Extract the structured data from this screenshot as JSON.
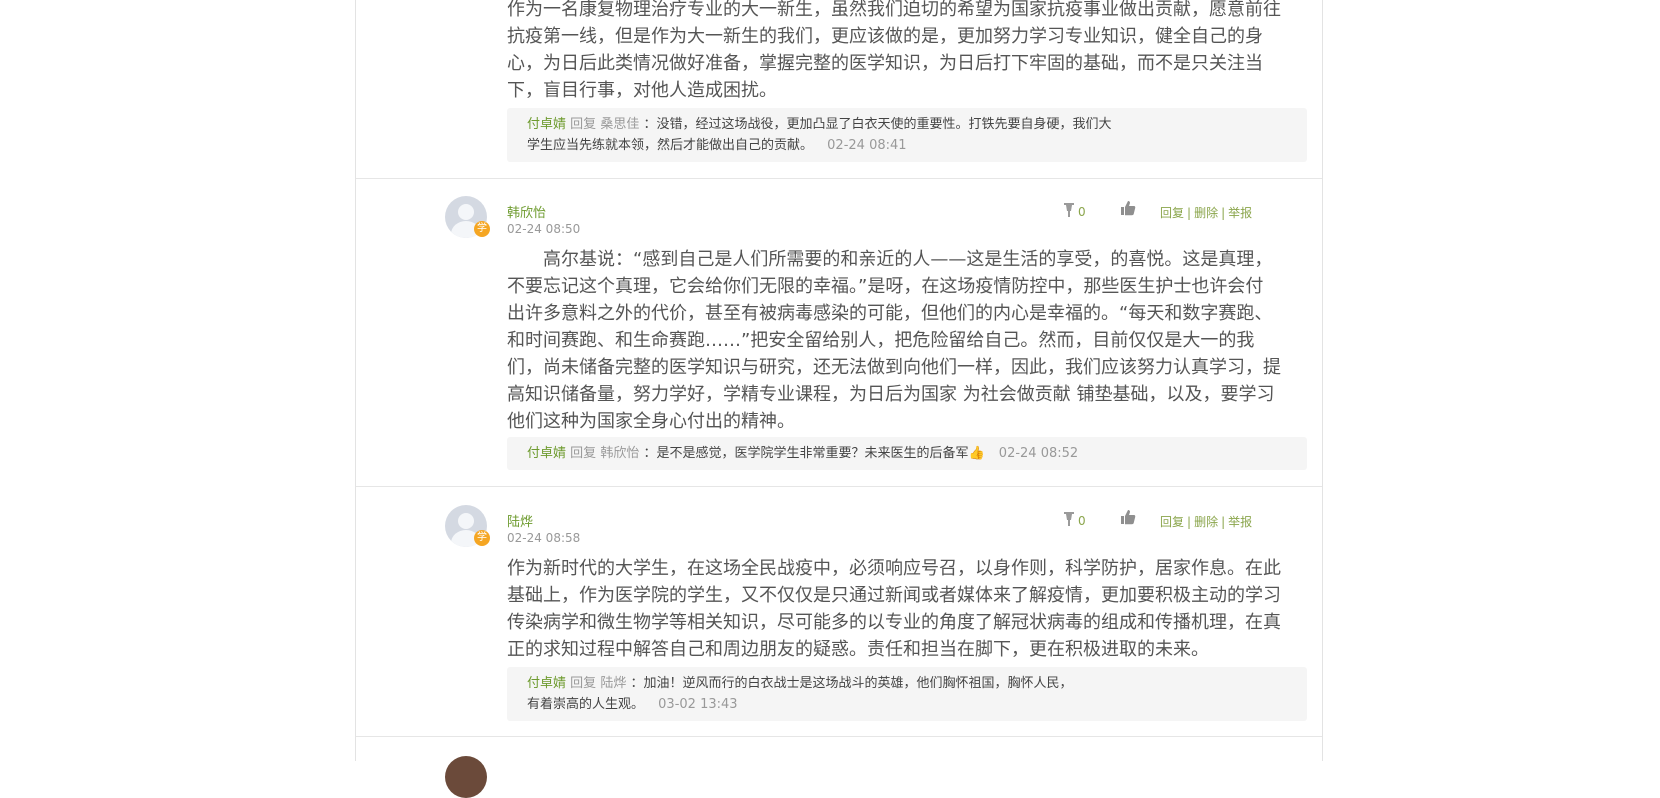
{
  "comments": [
    {
      "body_lines": [
        "作为一名康复物理治疗专业的大一新生，虽然我们迫切的希望为国家抗疫事业做出贡献，愿意前往",
        "抗疫第一线，但是作为大一新生的我们，更应该做的是，更加努力学习专业知识，健全自己的身",
        "心，为日后此类情况做好准备，掌握完整的医学知识，为日后打下牢固的基础，而不是只关注当",
        "下，盲目行事，对他人造成困扰。"
      ],
      "reply": {
        "author": "付卓婧",
        "word": "回复",
        "target": "桑思佳",
        "text_line1": "：没错，经过这场战役，更加凸显了白衣天使的重要性。打铁先要自身硬，我们大",
        "text_line2": "学生应当先练就本领，然后才能做出自己的贡献。",
        "time": "02-24 08:41"
      }
    },
    {
      "author": "韩欣怡",
      "time": "02-24 08:50",
      "badge": "学",
      "dislike_count": "0",
      "actions": {
        "reply": "回复",
        "delete": "删除",
        "report": "举报"
      },
      "body_lines": [
        "高尔基说：“感到自己是人们所需要的和亲近的人——这是生活的享受，的喜悦。这是真理，",
        "不要忘记这个真理，它会给你们无限的幸福。”是呀，在这场疫情防控中，那些医生护士也许会付",
        "出许多意料之外的代价，甚至有被病毒感染的可能，但他们的内心是幸福的。“每天和数字赛跑、",
        "和时间赛跑、和生命赛跑……”把安全留给别人，把危险留给自己。然而，目前仅仅是大一的我",
        "们，尚未储备完整的医学知识与研究，还无法做到向他们一样，因此，我们应该努力认真学习，提",
        "高知识储备量，努力学好，学精专业课程，为日后为国家 为社会做贡献 铺垫基础，以及，要学习",
        "他们这种为国家全身心付出的精神。"
      ],
      "reply": {
        "author": "付卓婧",
        "word": "回复",
        "target": "韩欣怡",
        "text_line1": "：是不是感觉，医学院学生非常重要？未来医生的后备军👍",
        "time": "02-24 08:52"
      }
    },
    {
      "author": "陆烨",
      "time": "02-24 08:58",
      "badge": "学",
      "dislike_count": "0",
      "actions": {
        "reply": "回复",
        "delete": "删除",
        "report": "举报"
      },
      "body_lines": [
        "作为新时代的大学生，在这场全民战疫中，必须响应号召，以身作则，科学防护，居家作息。在此",
        "基础上，作为医学院的学生，又不仅仅是只通过新闻或者媒体来了解疫情，更加要积极主动的学习",
        "传染病学和微生物学等相关知识，尽可能多的以专业的角度了解冠状病毒的组成和传播机理，在真",
        "正的求知过程中解答自己和周边朋友的疑惑。责任和担当在脚下，更在积极进取的未来。"
      ],
      "reply": {
        "author": "付卓婧",
        "word": "回复",
        "target": "陆烨",
        "text_line1": "：加油！逆风而行的白衣战士是这场战斗的英雄，他们胸怀祖国，胸怀人民，",
        "text_line2": "有着崇高的人生观。",
        "time": "03-02 13:43"
      }
    }
  ],
  "colors": {
    "accent": "#6e9b2f",
    "badge": "#f5a623",
    "reply_bg": "#f5f5f5"
  }
}
